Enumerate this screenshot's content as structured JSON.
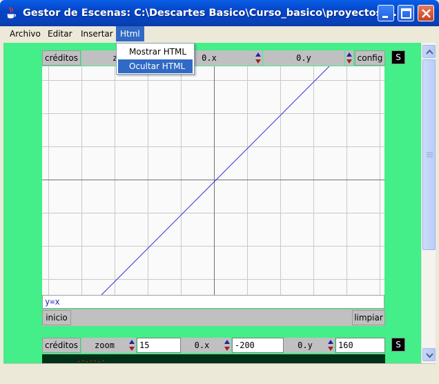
{
  "window": {
    "title": "Gestor de Escenas: C:\\Descartes Basico\\Curso_basico\\proyectos\\..."
  },
  "menubar": {
    "items": [
      {
        "label": "Archivo"
      },
      {
        "label": "Editar"
      },
      {
        "label": "Insertar"
      },
      {
        "label": "Html",
        "active": true
      }
    ]
  },
  "html_menu": {
    "items": [
      {
        "label": "Mostrar HTML"
      },
      {
        "label": "Ocultar HTML",
        "highlighted": true
      }
    ]
  },
  "applet1": {
    "creditos": "créditos",
    "zoom_label_partial": "z",
    "ox_label": "0.x",
    "oy_label": "0.y",
    "config": "config",
    "s_button": "S",
    "function_text": "y=x",
    "inicio": "inicio",
    "limpiar": "limpiar",
    "curve_color": "#2b2bd6"
  },
  "applet2": {
    "creditos": "créditos",
    "zoom_label": "zoom",
    "zoom_value": "15",
    "ox_label": "0.x",
    "ox_value": "-200",
    "oy_label": "0.y",
    "oy_value": "160",
    "s_button": "S"
  },
  "colors": {
    "applet_background": "#44ee88",
    "title_bar": "#0842b8",
    "menu_highlight": "#316ac5"
  }
}
